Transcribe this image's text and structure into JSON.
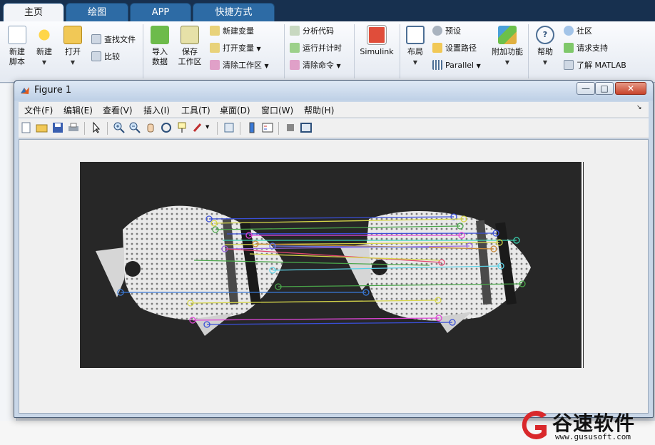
{
  "tabs": [
    "主页",
    "绘图",
    "APP",
    "快捷方式"
  ],
  "ribbon": {
    "new_script": "新建\n脚本",
    "new": "新建",
    "open": "打开",
    "find_files": "查找文件",
    "compare": "比较",
    "import_data": "导入\n数据",
    "save_workspace": "保存\n工作区",
    "new_variable": "新建变量",
    "open_variable": "打开变量",
    "clear_workspace": "清除工作区",
    "analyze_code": "分析代码",
    "run_time": "运行并计时",
    "clear_commands": "清除命令",
    "simulink": "Simulink",
    "layout": "布局",
    "preferences": "预设",
    "set_path": "设置路径",
    "parallel": "Parallel",
    "addons": "附加功能",
    "help": "帮助",
    "community": "社区",
    "request_support": "请求支持",
    "learn_matlab": "了解 MATLAB"
  },
  "figure": {
    "title": "Figure 1",
    "menus": [
      "文件(F)",
      "编辑(E)",
      "查看(V)",
      "插入(I)",
      "工具(T)",
      "桌面(D)",
      "窗口(W)",
      "帮助(H)"
    ],
    "min": "—",
    "max": "□",
    "close": "✕"
  },
  "watermark": {
    "name": "谷速软件",
    "url": "www.gususoft.com"
  },
  "colors": {
    "tabbar": "#17304f",
    "tab": "#2d6ba5",
    "plot_bg": "#262626",
    "match_colors": [
      "#3a4fd8",
      "#5bd1e6",
      "#e046d8",
      "#d6d64a",
      "#4aa64a",
      "#c88a3a",
      "#9b6ae0",
      "#e04670",
      "#3ad6b4",
      "#6a7ae8"
    ]
  }
}
